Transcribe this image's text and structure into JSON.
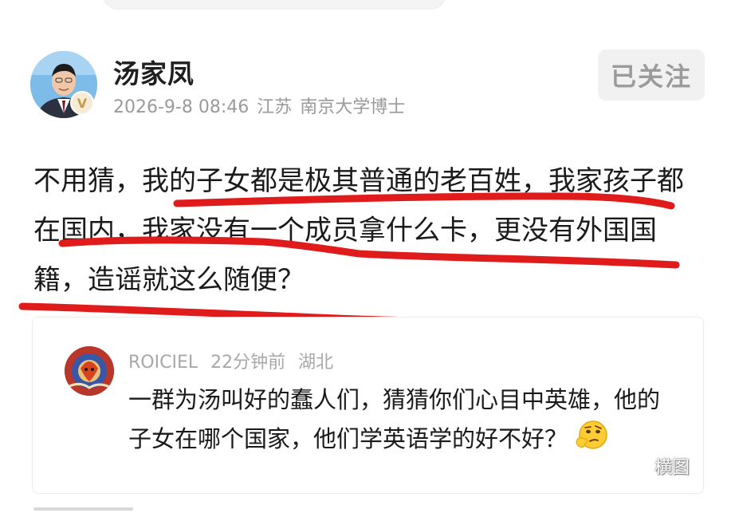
{
  "post": {
    "author": "汤家凤",
    "date": "2026-9-8 08:46",
    "location": "江苏",
    "tag": "南京大学博士",
    "follow_label": "已关注",
    "verified_badge": "V",
    "text": "不用猜，我的子女都是极其普通的老百姓，我家孩子都在国内，我家没有一个成员拿什么卡，更没有外国国籍，造谣就这么随便？"
  },
  "quoted_comment": {
    "username": "ROICIEL",
    "time": "22分钟前",
    "location": "湖北",
    "text": "一群为汤叫好的蠢人们，猜猜你们心目中英雄，他的子女在哪个国家，他们学英语学的好不好？",
    "emoji": "thinking-face-emoji"
  },
  "overlay_label": "横图",
  "colors": {
    "underline": "#e01b1b",
    "meta_text": "#9a9a9a",
    "badge_gold": "#c59d4a",
    "follow_bg": "#f1f1f1"
  }
}
